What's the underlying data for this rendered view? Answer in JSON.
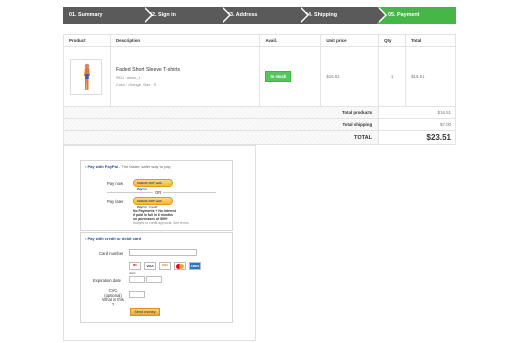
{
  "steps": [
    {
      "label": "01. Summary",
      "active": false
    },
    {
      "label": "02. Sign in",
      "active": false
    },
    {
      "label": "03. Address",
      "active": false
    },
    {
      "label": "04. Shipping",
      "active": false
    },
    {
      "label": "05. Payment",
      "active": true
    }
  ],
  "cart": {
    "headers": {
      "product": "Product",
      "description": "Description",
      "avail": "Avail.",
      "unit_price": "Unit price",
      "qty": "Qty",
      "total": "Total"
    },
    "item": {
      "name": "Faded Short Sleeve T-shirts",
      "sku": "SKU : demo_1",
      "color": "Color : Orange, Size : S",
      "availability": "In stock",
      "unit_price": "$16.51",
      "qty": "1",
      "total": "$16.51"
    },
    "totals": {
      "products_label": "Total products",
      "products_value": "$16.51",
      "shipping_label": "Total shipping",
      "shipping_value": "$7.00",
      "total_label": "TOTAL",
      "total_value": "$23.51"
    }
  },
  "payment": {
    "paypal": {
      "title": "Pay with PayPal",
      "tagline": "The faster, safer way to pay",
      "pay_now_label": "Pay now",
      "pay_now_button": "CHECK OUT",
      "with": "with",
      "brand_pay": "Pay",
      "brand_pal": "Pal",
      "or_label": "OR",
      "pay_later_label": "Pay later",
      "pay_later_button": "CHECK OUT",
      "credit_label": "Credit",
      "note_line1": "No Payments + No Interest",
      "note_line2": "if paid in full in 6 months",
      "note_line3": "on purchases of $99+",
      "note_line4": "Subject to credit approval. See terms"
    },
    "card": {
      "title": "Pay with credit or debit card",
      "card_number_label": "Card number",
      "card_brands": [
        "MC",
        "VISA",
        "DISC",
        "MC",
        "AMEX"
      ],
      "card_caption": "debit",
      "expiration_label": "Expiration date",
      "cvc_label": "CVC (optional)",
      "whats_this": "What is this ?",
      "send_button": "Send money"
    }
  },
  "colors": {
    "step_bg": "#5a5a5a",
    "step_active": "#46b649",
    "instock": "#55c65e"
  }
}
